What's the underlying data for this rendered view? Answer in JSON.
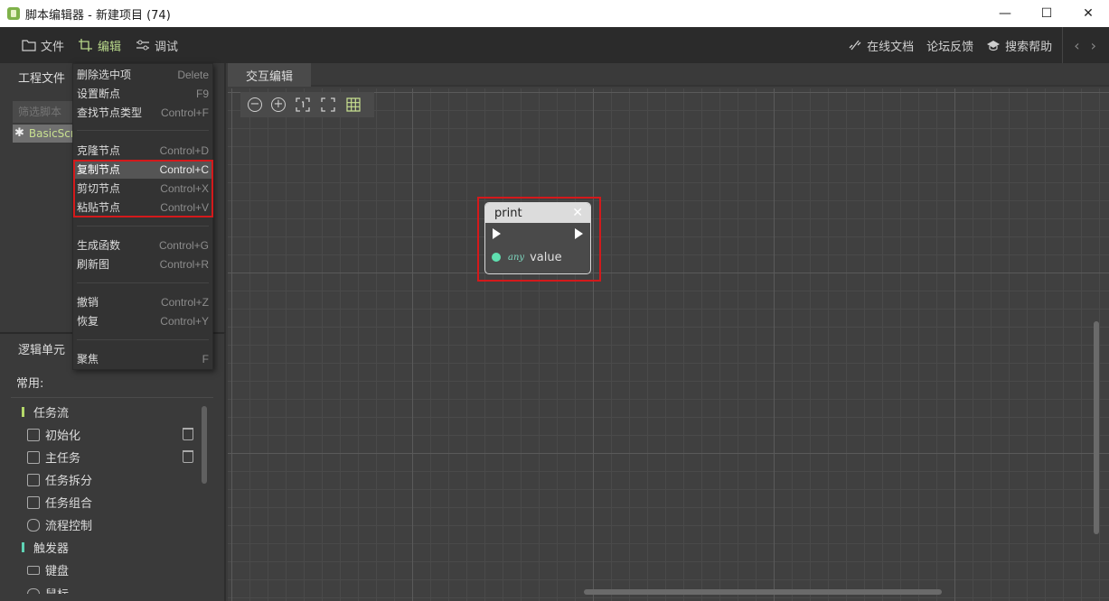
{
  "window": {
    "title": "脚本编辑器 - 新建项目 (74)",
    "controls": [
      "—",
      "☐",
      "✕"
    ]
  },
  "menubar": {
    "left": [
      {
        "label": "文件",
        "icon": "folder-icon",
        "active": false
      },
      {
        "label": "编辑",
        "icon": "crop-edit-icon",
        "active": true
      },
      {
        "label": "调试",
        "icon": "debug-sliders-icon",
        "active": false
      }
    ],
    "right": [
      {
        "label": "在线文档",
        "icon": "link-icon"
      },
      {
        "label": "论坛反馈",
        "icon": ""
      },
      {
        "label": "搜索帮助",
        "icon": "graduation-cap-icon"
      }
    ],
    "nav_prev": "‹",
    "nav_next": "›"
  },
  "project_panel": {
    "tab_label": "工程文件",
    "filter_placeholder": "筛选脚本",
    "script_item": "BasicScript"
  },
  "edit_menu": {
    "items": [
      {
        "label": "删除选中项",
        "shortcut": "Delete"
      },
      {
        "label": "设置断点",
        "shortcut": "F9"
      },
      {
        "label": "查找节点类型",
        "shortcut": "Control+F"
      },
      {
        "label": "克隆节点",
        "shortcut": "Control+D"
      },
      {
        "label": "复制节点",
        "shortcut": "Control+C"
      },
      {
        "label": "剪切节点",
        "shortcut": "Control+X"
      },
      {
        "label": "粘贴节点",
        "shortcut": "Control+V"
      },
      {
        "label": "生成函数",
        "shortcut": "Control+G"
      },
      {
        "label": "刷新图",
        "shortcut": "Control+R"
      },
      {
        "label": "撤销",
        "shortcut": "Control+Z"
      },
      {
        "label": "恢复",
        "shortcut": "Control+Y"
      },
      {
        "label": "聚焦",
        "shortcut": "F"
      }
    ],
    "highlighted_index": 4
  },
  "logic_panel": {
    "tab_label": "逻辑单元",
    "common_label": "常用:",
    "tree": [
      {
        "label": "任务流",
        "type": "category",
        "color": "#b5d96a"
      },
      {
        "label": "初始化",
        "type": "item",
        "icon": "document-icon",
        "trash": true
      },
      {
        "label": "主任务",
        "type": "item",
        "icon": "document-gear-icon",
        "trash": true
      },
      {
        "label": "任务拆分",
        "type": "item",
        "icon": "split-icon",
        "trash": false
      },
      {
        "label": "任务组合",
        "type": "item",
        "icon": "merge-icon",
        "trash": false
      },
      {
        "label": "流程控制",
        "type": "item",
        "icon": "flow-icon",
        "trash": false
      },
      {
        "label": "触发器",
        "type": "category",
        "color": "#5fd3b5"
      },
      {
        "label": "键盘",
        "type": "item",
        "icon": "keyboard-icon",
        "trash": false
      },
      {
        "label": "鼠标",
        "type": "item",
        "icon": "mouse-icon",
        "trash": false
      }
    ]
  },
  "editor": {
    "tab_label": "交互编辑",
    "toolbar": [
      "zoom-out-icon",
      "zoom-in-icon",
      "fit-one-icon",
      "fullscreen-icon",
      "grid-icon"
    ],
    "node": {
      "title": "print",
      "close": "✕",
      "port_type": "any",
      "port_label": "value",
      "port_color": "#5fe0b0"
    }
  }
}
